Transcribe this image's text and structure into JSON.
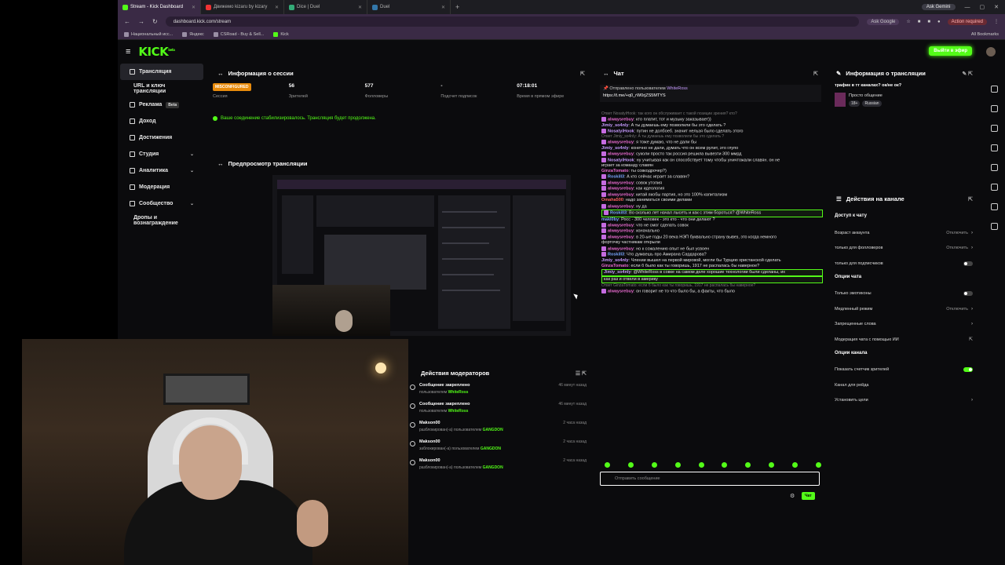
{
  "browser": {
    "tabs": [
      {
        "title": "Stream - Kick Dashboard",
        "active": true
      },
      {
        "title": "Движемо kizaru by kizary",
        "active": false
      },
      {
        "title": "Dice | Duel",
        "active": false
      },
      {
        "title": "Duel",
        "active": false
      }
    ],
    "ask_gemini": "Ask Gemini",
    "url": "dashboard.kick.com/stream",
    "ask_google": "Ask Google",
    "action_required": "Action required",
    "bookmarks": [
      "Национальный исс...",
      "Яндекс",
      "CSRoad - Buy & Sell...",
      "Kick"
    ],
    "all_bookmarks": "All Bookmarks"
  },
  "kick": {
    "logo": "KICK",
    "logo_sup": "beta",
    "go_live": "Выйти в эфир",
    "nav": [
      {
        "label": "Трансляция",
        "icon": "broadcast-icon",
        "active": true
      },
      {
        "label": "URL и ключ трансляции",
        "sub": true
      },
      {
        "label": "Реклама",
        "icon": "ads-icon",
        "badge": "Beta"
      },
      {
        "label": "Доход",
        "icon": "money-icon"
      },
      {
        "label": "Достижения",
        "icon": "trophy-icon"
      },
      {
        "label": "Студия",
        "icon": "studio-icon",
        "chevron": true
      },
      {
        "label": "Аналитика",
        "icon": "analytics-icon",
        "chevron": true
      },
      {
        "label": "Модерация",
        "icon": "shield-icon"
      },
      {
        "label": "Сообщество",
        "icon": "community-icon",
        "chevron": true
      },
      {
        "label": "Дропы и вознаграждение",
        "sub": true
      }
    ],
    "session": {
      "title": "Информация о сессии",
      "stats": [
        {
          "value": "MISCONFIGURED",
          "label": "Сессия"
        },
        {
          "value": "56",
          "label": "Зрителей"
        },
        {
          "value": "577",
          "label": "Фолловеры"
        },
        {
          "value": "-",
          "label": "Подсчет подписок"
        },
        {
          "value": "07:18:01",
          "label": "Время в прямом эфире"
        }
      ],
      "status": "Ваше соединение стабилизировалось. Трансляция будет продолжена."
    },
    "preview_title": "Предпросмотр трансляции",
    "chat": {
      "title": "Чат",
      "pinned_by": "Отправлено пользователем",
      "pinned_user": "WhiteRoss",
      "pinned_link": "https://t.me/+q0_rW0rjZS5MTYS",
      "messages": [
        {
          "reply": "Ответ NosatyiHook: так кого он обслуживает с такой позиции зрения? кто?"
        },
        {
          "user": "alwaysrebuy",
          "color": "#e96bd0",
          "badge": true,
          "text": ": кто платит, тот и музыку заказывает))"
        },
        {
          "user": "Jimiy_so4nly",
          "color": "#c79bff",
          "text": ": А ты думаешь ему позволили бы это сделать ?"
        },
        {
          "user": "NosatyiHook",
          "color": "#c79bff",
          "badge": true,
          "text": ": путин не долбоеб. значит нельзя было сделать этого"
        },
        {
          "reply": "Ответ Jimiy_so4nly: А ты думаешь ему позволили бы это сделать ?"
        },
        {
          "user": "alwaysrebuy",
          "color": "#e96bd0",
          "badge": true,
          "text": ": я тоже думаю, что не дали бы"
        },
        {
          "user": "Jimiy_so4nly",
          "color": "#c79bff",
          "text": ": конечно не дали, думать что он всем рулит, это глупо"
        },
        {
          "user": "alwaysrebuy",
          "color": "#e96bd0",
          "badge": true,
          "text": ": суколи просто так россия решила вывезти 300 ммрд"
        },
        {
          "user": "NosatyiHook",
          "color": "#c79bff",
          "badge": true,
          "text": ": ну учитывая как он способствует тому чтобы уничтожали славян. он не"
        },
        {
          "text": "играет за команду славян"
        },
        {
          "user": "GinzaTomato",
          "color": "#e96bd0",
          "text": ": ты совкодрочер?)"
        },
        {
          "user": "Roskill3",
          "color": "#7aa7ff",
          "badge": true,
          "text": ": А кто сейчас играет за славян?"
        },
        {
          "user": "alwaysrebuy",
          "color": "#e96bd0",
          "badge": true,
          "text": ": совок утопия"
        },
        {
          "user": "alwaysrebuy",
          "color": "#e96bd0",
          "badge": true,
          "text": ": как идеология"
        },
        {
          "user": "alwaysrebuy",
          "color": "#e96bd0",
          "badge": true,
          "text": ": китай якобы партия, но это 100% капитализм"
        },
        {
          "user": "Omaha500",
          "color": "#ff5f5f",
          "text": ": надо заниматься своими делами"
        },
        {
          "user": "alwaysrebuy",
          "color": "#e96bd0",
          "badge": true,
          "text": ": ну да"
        },
        {
          "user": "Roskill3",
          "color": "#7aa7ff",
          "badge": true,
          "highlight": true,
          "text": ": Во сколько лет начал лысеть и как с этим бороться? @WhiteRoss"
        },
        {
          "user": "makl0by",
          "color": "#7aa7ff",
          "text": ": Росс - 300 человек - это кто - что они делают ?"
        },
        {
          "user": "alwaysrebuy",
          "color": "#e96bd0",
          "badge": true,
          "text": ": что не смог сделать совок"
        },
        {
          "user": "alwaysrebuy",
          "color": "#e96bd0",
          "badge": true,
          "text": ": изначально"
        },
        {
          "user": "alwaysrebuy",
          "color": "#e96bd0",
          "badge": true,
          "text": ": в 20-ые годы 20 века НЭП буквально страну вывез, это когда немного"
        },
        {
          "text": "форточку частникам открыли"
        },
        {
          "user": "alwaysrebuy",
          "color": "#e96bd0",
          "badge": true,
          "text": ": но к сожалению опыт не был усвоен"
        },
        {
          "user": "Roskill3",
          "color": "#7aa7ff",
          "badge": true,
          "text": ": Что думаешь про Амирана Сардарова?"
        },
        {
          "user": "Jimiy_so4nly",
          "color": "#c79bff",
          "text": ": Члении вышел на первой мировой, могли бы Турцию христанской сделать"
        },
        {
          "user": "GinzaTomato",
          "color": "#e96bd0",
          "text": ": если б было как ты говоришь, 1917 не распалась бы наверное?"
        },
        {
          "user": "Jimiy_so4nly",
          "color": "#c79bff",
          "highlight": true,
          "text": ": @WhiteRoss в совке на самом деле хорошие технологии были сделаны, их"
        },
        {
          "highlight": true,
          "text": "как раз и отвели в америку"
        },
        {
          "reply": "Ответ GinzaTomato: если б было как ты говоришь, 1917 не распалась бы наверное?"
        },
        {
          "user": "alwaysrebuy",
          "color": "#e96bd0",
          "badge": true,
          "text": ": он говорит не то что было бы, а факты, что было"
        }
      ],
      "input_placeholder": "Отправить сообщение",
      "send_label": "Чат"
    },
    "stream_info": {
      "title": "Информация о трансляции",
      "question": "трафик в тт каналах? ок/не ок?",
      "category": "Просто общение",
      "tags": [
        "18+",
        "Russian"
      ]
    },
    "channel_actions": {
      "title": "Действия на канале",
      "sections": [
        {
          "heading": "Доступ к чату",
          "items": [
            {
              "label": "Возраст аккаунта",
              "value": "Отключить",
              "kind": "select"
            },
            {
              "label": "только для фолловеров",
              "value": "Отключить",
              "kind": "select"
            },
            {
              "label": "только для подписчиков",
              "kind": "toggle",
              "on": false
            }
          ]
        },
        {
          "heading": "Опции чата",
          "items": [
            {
              "label": "Только эмотиконы",
              "kind": "toggle",
              "on": false
            },
            {
              "label": "Медленный режим",
              "value": "Отключить",
              "kind": "select"
            },
            {
              "label": "Запрещенные слова",
              "kind": "link"
            },
            {
              "label": "Модерация чата с помощью ИИ",
              "kind": "ext"
            }
          ]
        },
        {
          "heading": "Опции канала",
          "items": [
            {
              "label": "Показать счетчик зрителей",
              "kind": "toggle",
              "on": true
            },
            {
              "label": "Канал для рейда",
              "kind": "none"
            },
            {
              "label": "Установить цели",
              "kind": "link"
            }
          ]
        }
      ]
    },
    "mod_actions": {
      "title": "Действия модераторов",
      "rows": [
        {
          "title": "Сообщение закреплено",
          "detail": "пользователем",
          "who": "WhiteRoss",
          "time": "46 минут назад"
        },
        {
          "title": "Сообщение закреплено",
          "detail": "пользователем",
          "who": "WhiteRoss",
          "time": "46 минут назад"
        },
        {
          "title": "Makson00",
          "detail": "разблокирован(-а) пользователем",
          "who": "GANGDON",
          "time": "2 часа назад"
        },
        {
          "title": "Makson00",
          "detail": "заблокирован(-а) пользователем",
          "who": "GANGDON",
          "time": "2 часа назад"
        },
        {
          "title": "Makson00",
          "detail": "разблокирован(-а) пользователем",
          "who": "GANGDON",
          "time": "2 часа назад"
        }
      ]
    }
  }
}
